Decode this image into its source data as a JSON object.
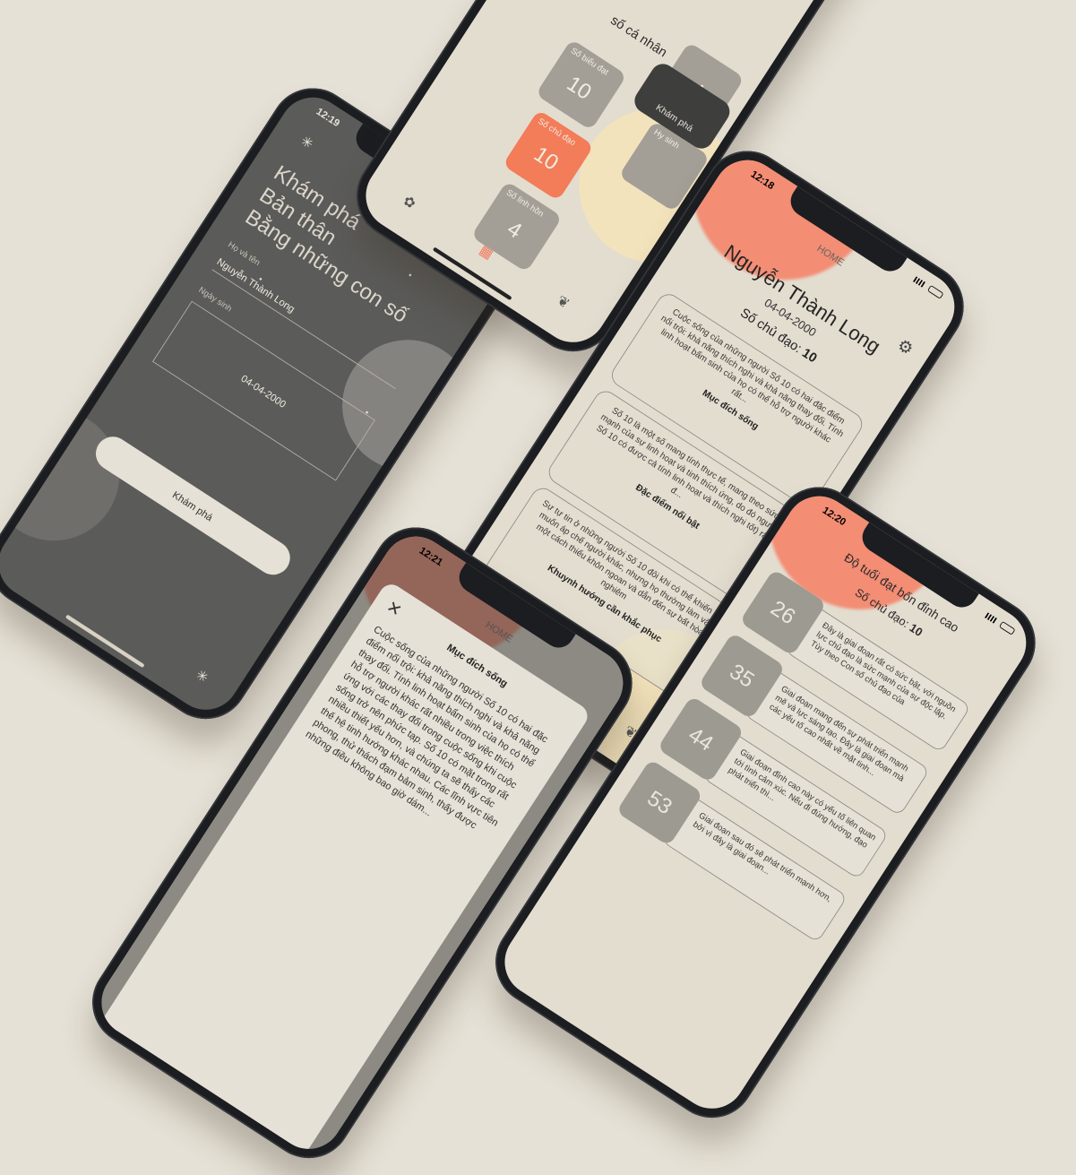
{
  "colors": {
    "background": "#e6e1d6",
    "accent": "#f37c59",
    "dark": "#5b5b59"
  },
  "onboarding": {
    "time": "12:19",
    "hero_lines": [
      "Khám phá",
      "Bản thân",
      "Bằng những con số"
    ],
    "name_label": "Họ và tên",
    "name_value": "Nguyễn Thành Long",
    "dob_label": "Ngày sinh",
    "dob_value": "04-04-2000",
    "cta": "Khám phá",
    "star_icon": "sparkle-icon"
  },
  "home": {
    "time": "12:18",
    "nav_title": "HOME",
    "user_name": "Nguyễn Thành Long",
    "dob": "04-04-2000",
    "main_number_label": "Số chủ đạo:",
    "main_number_value": "10",
    "cards": [
      {
        "intro": "Cuộc sống của những người Số 10 có hai đặc điểm nổi trội: khả năng thích nghi và khả năng thay đổi. Tính linh hoạt bẩm sinh của họ có thể hỗ trợ người khác rất...",
        "title": "Mục đích sống"
      },
      {
        "intro": "Số 10 là một số mang tính thực tế, mang theo sức mạnh của sự linh hoạt và tinh thích ứng, do đó người Số 10 có được cả tính linh hoạt và thích nghi tốt) rất đ...",
        "title": "Đặc điểm nổi bật"
      },
      {
        "intro": "Sự tự tin ở những người Số 10 đôi khi có thể khiến họ muốn áp chế người khác, nhưng họ thường làm vậy một cách thiếu khôn ngoan và dẫn đến sự bất hòa nghiêm",
        "title": "Khuynh hướng cần khắc phục"
      }
    ]
  },
  "modal": {
    "time": "12:21",
    "title": "Mục đích sống",
    "nav_title": "HOME",
    "body": "Cuộc sống của những người Số 10 có hai đặc điểm nổi trội: khả năng thích nghi và khả năng thay đổi. Tính linh hoạt bẩm sinh của họ có thể hỗ trợ người khác rất nhiều trong việc thích ứng với các thay đổi trong cuộc sống khi cuộc sống trở nên phức tạp. Số 10 có mặt trong rất nhiều thiết yếu hơn, và chúng ta sẽ thấy các thế hệ tinh hướng khác nhau. Các lĩnh vực tiên phong, thử thách đạm bảm sinh, thấy được những điều không bao giờ dám..."
  },
  "ages": {
    "time": "12:20",
    "title": "Độ tuổi đạt bốn đỉnh cao",
    "main_number_label": "Số chủ đạo:",
    "main_number_value": "10",
    "items": [
      {
        "age": "26",
        "text": "Đây là giai đoạn rất có sức bật, với nguồn lực chủ đạo là sức mạnh của sự độc lập. Tùy theo Con số chủ đạo của"
      },
      {
        "age": "35",
        "text": "Giai đoạn mang đến sự phát triển mạnh mẽ và lực sáng tạo. Đây là giai đoạn mà các yếu tố cao nhất về mặt tinh..."
      },
      {
        "age": "44",
        "text": "Giai đoạn đỉnh cao này có yếu tố liên quan tới tình cảm xúc. Nếu đi đúng hướng, đạo phát triển thì..."
      },
      {
        "age": "53",
        "text": "Giai đoạn sau đó sẽ phát triển mạnh hơn, bởi vì đây là giai đoạn..."
      }
    ]
  },
  "grid": {
    "title": "số cá nhân",
    "explore": "Khám phá",
    "tiles": [
      {
        "label": "Số biểu đạt",
        "value": "10"
      },
      {
        "label": "Số chủ đạo",
        "value": "10"
      },
      {
        "label": "Số linh hồn",
        "value": "4"
      },
      {
        "label": "Hy sinh",
        "value": ""
      },
      {
        "label": "",
        "value": "4"
      }
    ]
  }
}
